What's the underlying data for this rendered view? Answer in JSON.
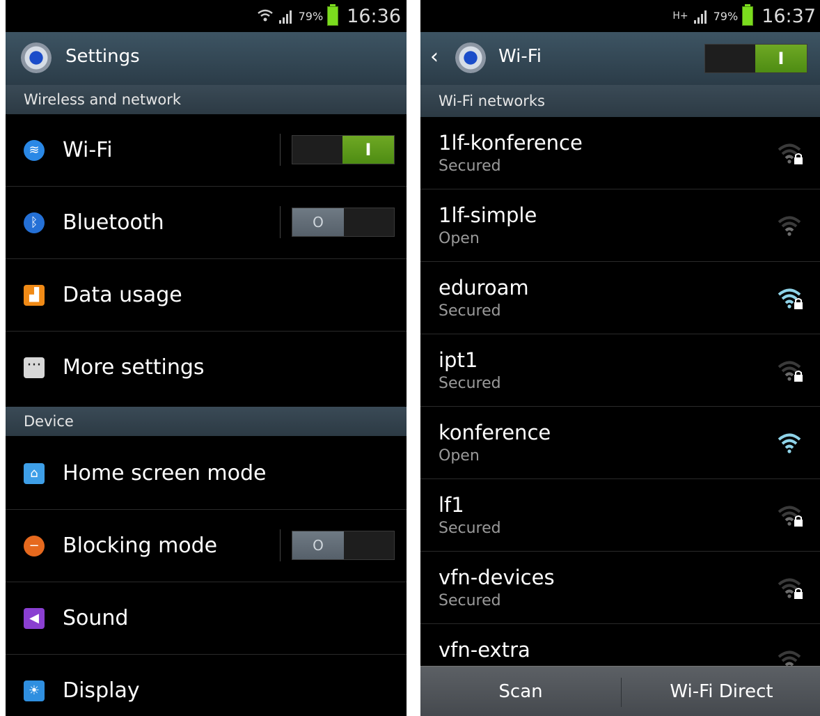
{
  "left": {
    "status": {
      "battery": "79%",
      "time": "16:36"
    },
    "header": {
      "title": "Settings"
    },
    "sections": {
      "wireless": "Wireless and network",
      "device": "Device"
    },
    "items": {
      "wifi": "Wi-Fi",
      "bluetooth": "Bluetooth",
      "data_usage": "Data usage",
      "more": "More settings",
      "home": "Home screen mode",
      "blocking": "Blocking mode",
      "sound": "Sound",
      "display": "Display"
    },
    "toggles": {
      "wifi": "on",
      "bluetooth": "off",
      "blocking": "off"
    }
  },
  "right": {
    "status": {
      "network": "H+",
      "battery": "79%",
      "time": "16:37"
    },
    "header": {
      "title": "Wi-Fi",
      "toggle": "on"
    },
    "section": "Wi-Fi networks",
    "networks": [
      {
        "name": "1lf-konference",
        "security": "Secured",
        "strength": "weak"
      },
      {
        "name": "1lf-simple",
        "security": "Open",
        "strength": "weak"
      },
      {
        "name": "eduroam",
        "security": "Secured",
        "strength": "strong"
      },
      {
        "name": "ipt1",
        "security": "Secured",
        "strength": "weak"
      },
      {
        "name": "konference",
        "security": "Open",
        "strength": "strong"
      },
      {
        "name": "lf1",
        "security": "Secured",
        "strength": "weak"
      },
      {
        "name": "vfn-devices",
        "security": "Secured",
        "strength": "weak"
      },
      {
        "name": "vfn-extra",
        "security": "",
        "strength": "weak"
      }
    ],
    "buttons": {
      "scan": "Scan",
      "wifi_direct": "Wi-Fi Direct"
    }
  },
  "icons": {
    "switch_on_glyph": "I",
    "switch_off_glyph": "O"
  },
  "colors": {
    "accent_green": "#5a9a16",
    "wifi_active": "#8fd3e8",
    "wifi_inactive": "#6c6c6c"
  }
}
